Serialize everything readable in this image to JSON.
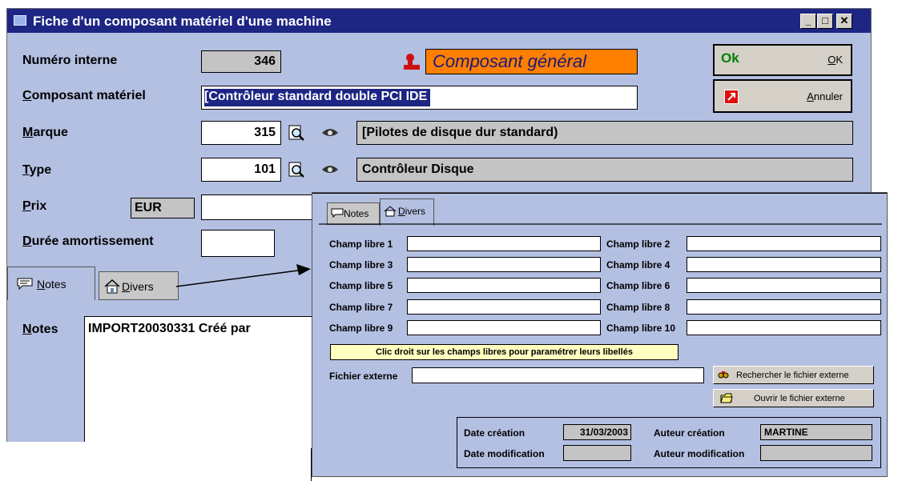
{
  "window": {
    "title": "Fiche d'un composant matériel d'une machine",
    "controls": {
      "minimize": "_",
      "maximize": "□",
      "close": "✕"
    }
  },
  "form": {
    "numero_interne": {
      "label": "Numéro interne",
      "value": "346"
    },
    "badge": "Composant général",
    "composant": {
      "label_initial": "C",
      "label_rest": "omposant matériel",
      "value": "[Contrôleur standard double PCI IDE"
    },
    "marque": {
      "label_initial": "M",
      "label_rest": "arque",
      "code": "315",
      "desc": "[Pilotes de disque dur standard)"
    },
    "type": {
      "label_initial": "T",
      "label_rest": "ype",
      "code": "101",
      "desc": "Contrôleur Disque"
    },
    "prix": {
      "label_initial": "P",
      "label_rest": "rix",
      "currency": "EUR"
    },
    "duree": {
      "label_initial": "D",
      "label_rest": "urée amortissement"
    }
  },
  "buttons": {
    "ok": {
      "glyph": "Ok",
      "label_initial": "O",
      "label_rest": "K"
    },
    "annuler": {
      "label_initial": "A",
      "label_rest": "nnuler"
    }
  },
  "tabs": {
    "notes": {
      "label_initial": "N",
      "label_rest": "otes"
    },
    "divers": {
      "label_initial": "D",
      "label_rest": "ivers"
    }
  },
  "notes": {
    "label_initial": "N",
    "label_rest": "otes",
    "text": "IMPORT20030331 Créé par"
  },
  "divers_panel": {
    "tabs": {
      "notes": "Notes",
      "divers_initial": "D",
      "divers_rest": "ivers"
    },
    "champs": [
      "Champ libre 1",
      "Champ libre 2",
      "Champ libre 3",
      "Champ libre 4",
      "Champ libre 5",
      "Champ libre 6",
      "Champ libre 7",
      "Champ libre 8",
      "Champ libre 9",
      "Champ libre 10"
    ],
    "hint": "Clic droit sur les champs libres pour paramétrer leurs libellés",
    "fichier_externe_label": "Fichier externe",
    "btn_rechercher": "Rechercher le fichier externe",
    "btn_ouvrir": "Ouvrir le fichier externe",
    "date_creation_label": "Date création",
    "date_creation": "31/03/2003",
    "date_modification_label": "Date modification",
    "auteur_creation_label": "Auteur création",
    "auteur_creation": "MARTINE",
    "auteur_modification_label": "Auteur modification"
  },
  "colors": {
    "form_bg": "#b4c0e2",
    "title_bar": "#1d2683",
    "badge_bg": "#ff7f00",
    "ok_green": "#008000"
  }
}
